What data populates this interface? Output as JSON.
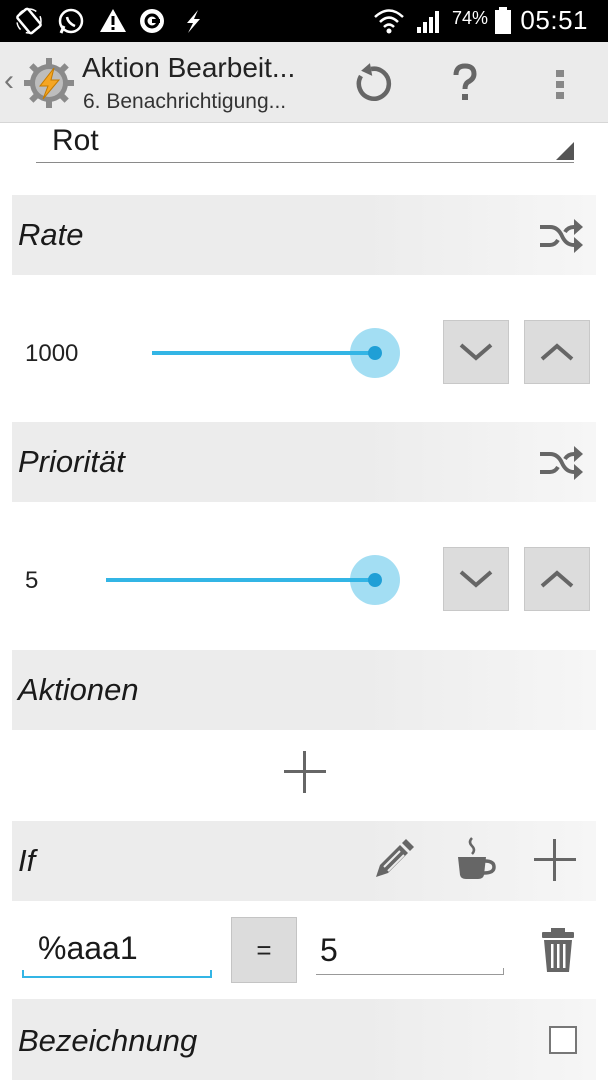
{
  "status_bar": {
    "icons": [
      "screen-rotation-icon",
      "whatsapp-icon",
      "warning-icon",
      "sync-icon",
      "flash-icon",
      "wifi-icon",
      "signal-icon",
      "battery-icon"
    ],
    "battery": "74%",
    "time": "05:51"
  },
  "app_bar": {
    "title": "Aktion Bearbeit...",
    "subtitle": "6. Benachrichtigung...",
    "actions": [
      "undo-icon",
      "help-icon",
      "overflow-menu-icon"
    ]
  },
  "dropdown": {
    "value": "Rot"
  },
  "sections": {
    "rate": {
      "title": "Rate",
      "icon": "shuffle-icon"
    },
    "prioritaet": {
      "title": "Priorität",
      "icon": "shuffle-icon"
    },
    "aktionen": {
      "title": "Aktionen",
      "icon": "plus-icon"
    },
    "if": {
      "title": "If",
      "icons": [
        "edit-icon",
        "coffee-icon",
        "plus-icon"
      ]
    },
    "bezeichnung": {
      "title": "Bezeichnung",
      "checked": false
    }
  },
  "rate_slider": {
    "value_label": "1000",
    "level": 1.0
  },
  "priority_slider": {
    "value_label": "5",
    "level": 1.0
  },
  "condition": {
    "left": "%aaa1",
    "operator": "=",
    "right": "5"
  },
  "colors": {
    "accent": "#33b5e5",
    "section_bg": "#ececec",
    "button_bg": "#dcdcdc"
  }
}
